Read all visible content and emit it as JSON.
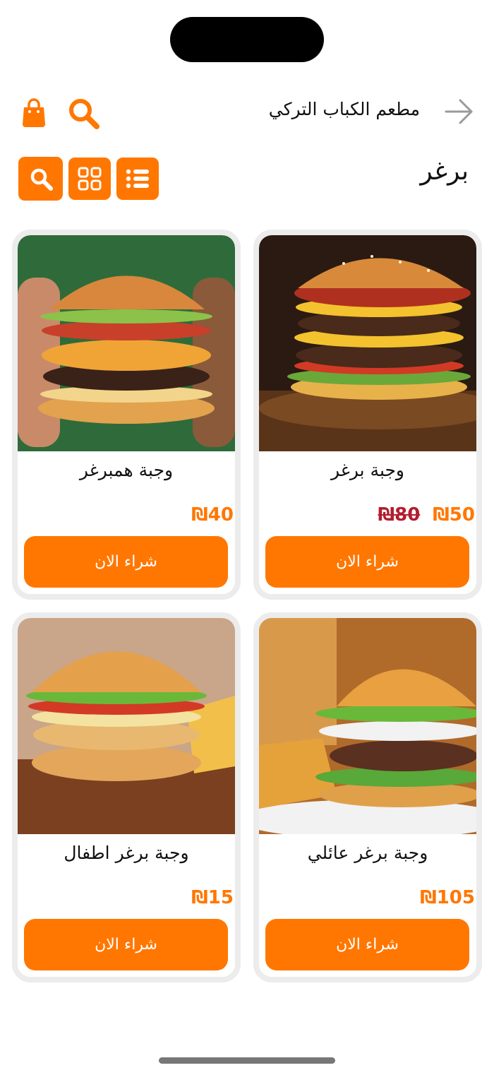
{
  "header": {
    "restaurant_name": "مطعم الكباب التركي"
  },
  "category": {
    "title": "برغر"
  },
  "colors": {
    "accent": "#ff7700",
    "old_price": "#b31d2f",
    "card_border": "#ececec"
  },
  "products": [
    {
      "name": "وجبة برغر",
      "price": "₪50",
      "old_price": "₪80",
      "button": "شراء الان"
    },
    {
      "name": "وجبة همبرغر",
      "price": "₪40",
      "old_price": "",
      "button": "شراء الان"
    },
    {
      "name": "وجبة برغر عائلي",
      "price": "₪105",
      "old_price": "",
      "button": "شراء الان"
    },
    {
      "name": "وجبة برغر اطفال",
      "price": "₪15",
      "old_price": "",
      "button": "شراء الان"
    }
  ],
  "icons": [
    "back-arrow-icon",
    "search-icon",
    "shopping-bag-icon",
    "list-view-icon",
    "grid-view-icon"
  ]
}
